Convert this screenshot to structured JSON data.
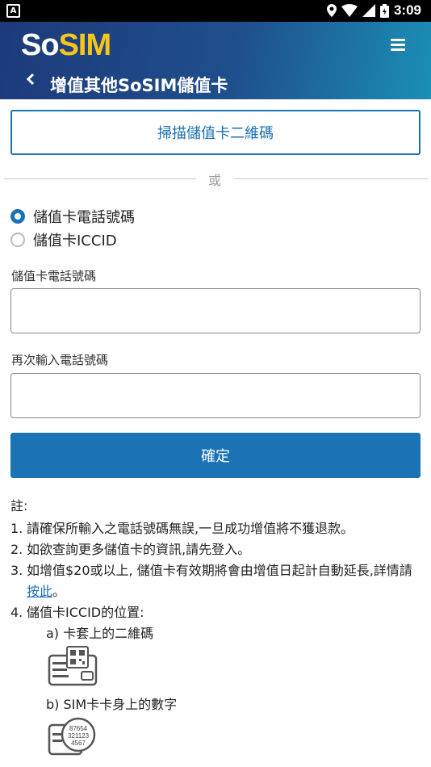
{
  "status_bar": {
    "left_badge": "A",
    "time": "3:09"
  },
  "header": {
    "logo_part1": "So",
    "logo_part2": "SIM",
    "back_icon": "chevron-left-icon",
    "title": "增值其他SoSIM儲值卡",
    "menu_icon": "hamburger-menu-icon"
  },
  "scan_button": {
    "label": "掃描儲值卡二維碼"
  },
  "divider": {
    "label": "或"
  },
  "radio_options": [
    {
      "label": "儲值卡電話號碼",
      "selected": true
    },
    {
      "label": "儲值卡ICCID",
      "selected": false
    }
  ],
  "fields": {
    "phone_label": "儲值卡電話號碼",
    "phone_value": "",
    "phone_confirm_label": "再次輸入電話號碼",
    "phone_confirm_value": ""
  },
  "confirm_button": {
    "label": "確定"
  },
  "notes": {
    "title": "註:",
    "items": [
      {
        "num": "1.",
        "text": "請確保所輸入之電話號碼無誤,一旦成功增值將不獲退款。"
      },
      {
        "num": "2.",
        "text": "如欲查詢更多儲值卡的資訊,請先登入。"
      },
      {
        "num": "3.",
        "text_before": "如增值$20或以上, 儲值卡有效期將會由增值日起計自動延長,詳情請",
        "link": "按此",
        "text_after": "。"
      },
      {
        "num": "4.",
        "text": "儲值卡ICCID的位置:"
      }
    ],
    "sub_a": "a) 卡套上的二維碼",
    "sub_b": "b) SIM卡卡身上的數字",
    "card_qr_icon": "card-qr-icon",
    "sim_number_icon": "sim-number-icon",
    "sim_digits": [
      "87654",
      "321123",
      "4567"
    ]
  },
  "colors": {
    "accent": "#1b73b4",
    "logo_yellow": "#f5c51a",
    "header_start": "#1d3a7a",
    "header_end": "#1b8fb6"
  }
}
